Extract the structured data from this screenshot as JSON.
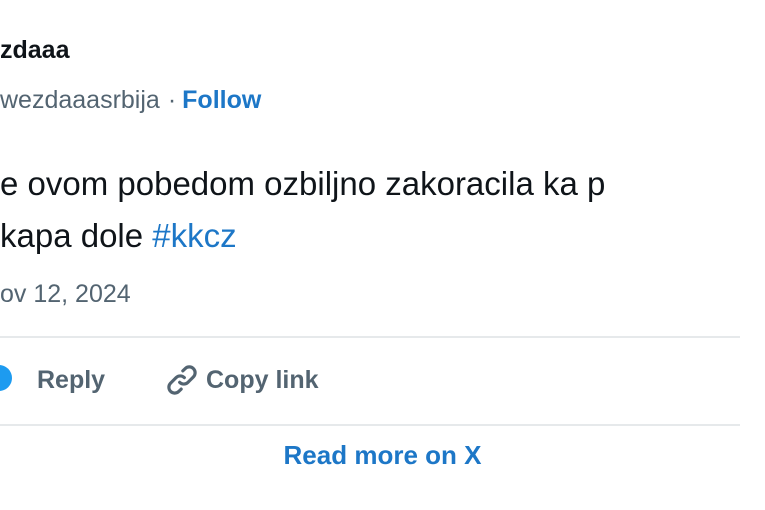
{
  "author": {
    "display_name": "zdaaa",
    "handle": "wezdaaasrbija",
    "separator": "·",
    "follow_label": "Follow"
  },
  "tweet": {
    "line1": "e ovom pobedom ozbiljno zakoracila ka p",
    "line2_text": "kapa dole ",
    "hashtag": "#kkcz",
    "date": "ov 12, 2024"
  },
  "actions": {
    "reply_label": "Reply",
    "copy_link_label": "Copy link"
  },
  "footer": {
    "read_more_label": "Read more on X"
  },
  "colors": {
    "link": "#1d77c7",
    "secondary_text": "#536471",
    "primary_text": "#0f1419",
    "divider": "#e6e9eb",
    "like_accent": "#1d9bf0"
  },
  "icons": {
    "like": "heart-icon",
    "reply": "reply-icon",
    "copy_link": "link-icon"
  }
}
